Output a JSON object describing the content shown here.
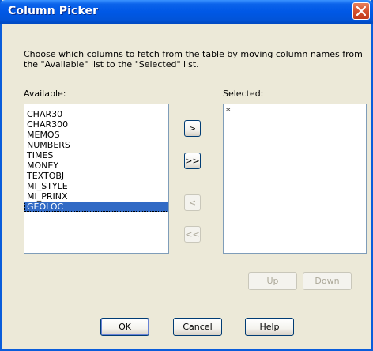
{
  "window": {
    "title": "Column Picker"
  },
  "instructions": "Choose which columns to fetch from the table by moving column names from the \"Available\" list to the \"Selected\" list.",
  "available": {
    "label": "Available:",
    "items": [
      "CHAR30",
      "CHAR300",
      "MEMOS",
      "NUMBERS",
      "TIMES",
      "MONEY",
      "TEXTOBJ",
      "MI_STYLE",
      "MI_PRINX",
      "GEOLOC"
    ],
    "selected_item": "GEOLOC"
  },
  "selected": {
    "label": "Selected:",
    "items": [
      "*"
    ]
  },
  "move_buttons": {
    "add": ">",
    "add_all": ">>",
    "remove": "<",
    "remove_all": "<<"
  },
  "order_buttons": {
    "up": "Up",
    "down": "Down"
  },
  "dialog_buttons": {
    "ok": "OK",
    "cancel": "Cancel",
    "help": "Help"
  },
  "colors": {
    "titlebar": "#0058E6",
    "selection": "#316AC5",
    "dialog_bg": "#ECE9D8",
    "close_button": "#D4512E"
  }
}
